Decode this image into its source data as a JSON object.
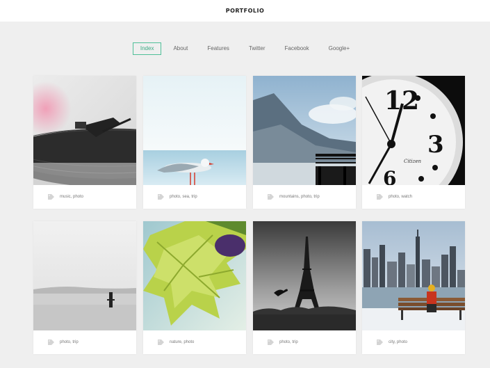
{
  "site": {
    "title": "PORTFOLIO"
  },
  "nav": {
    "items": [
      {
        "label": "Index",
        "active": true
      },
      {
        "label": "About"
      },
      {
        "label": "Features"
      },
      {
        "label": "Twitter"
      },
      {
        "label": "Facebook"
      },
      {
        "label": "Google+"
      }
    ]
  },
  "colors": {
    "accent": "#4fbf98",
    "background": "#efefef",
    "card": "#ffffff"
  },
  "cards": [
    {
      "tags": "music, photo",
      "image": "turntable"
    },
    {
      "tags": "photo, sea, trip",
      "image": "seagull"
    },
    {
      "tags": "mountains, photo, trip",
      "image": "mountains-pier"
    },
    {
      "tags": "photo, watch",
      "image": "clock"
    },
    {
      "tags": "photo, trip",
      "image": "misty-sea-post"
    },
    {
      "tags": "nature, photo",
      "image": "leaf"
    },
    {
      "tags": "photo, trip",
      "image": "eiffel-tower"
    },
    {
      "tags": "city, photo",
      "image": "city-bench"
    }
  ],
  "icons": {
    "tag": "tag-icon"
  }
}
